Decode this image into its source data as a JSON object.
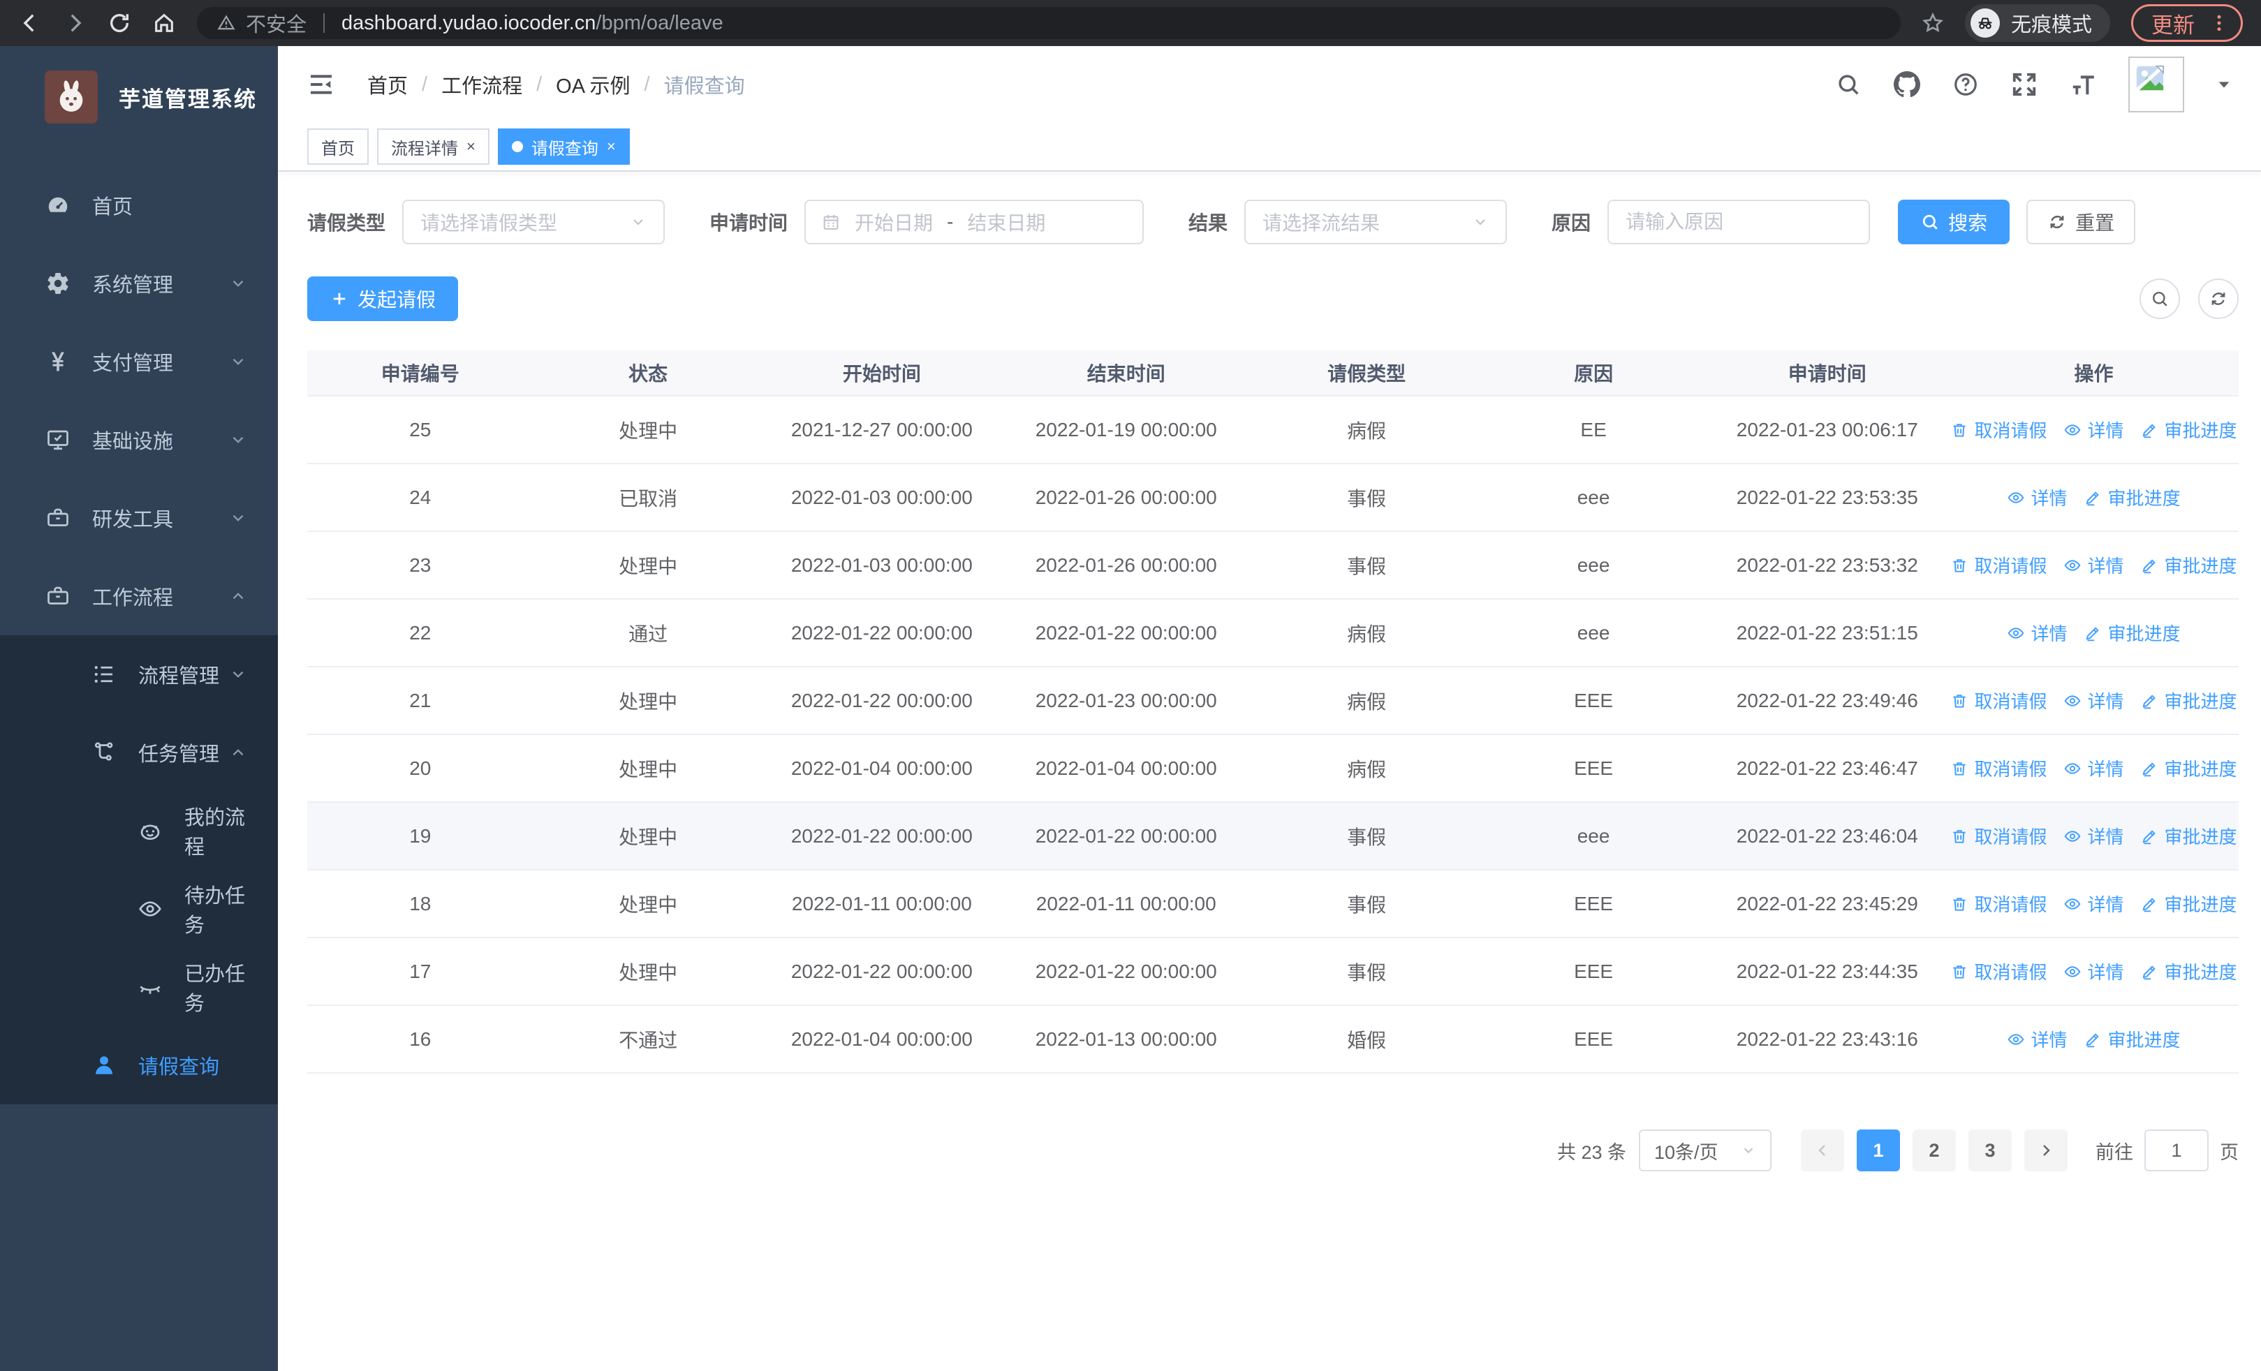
{
  "browser": {
    "security_warning": "不安全",
    "url_host": "dashboard.yudao.iocoder.cn",
    "url_path": "/bpm/oa/leave",
    "incognito_label": "无痕模式",
    "update_label": "更新"
  },
  "sidebar": {
    "logo_title": "芋道管理系统",
    "menu": [
      {
        "label": "首页",
        "icon": "dashboard-icon",
        "chevron": null
      },
      {
        "label": "系统管理",
        "icon": "gear-icon",
        "chevron": "down"
      },
      {
        "label": "支付管理",
        "icon": "yen-icon",
        "chevron": "down"
      },
      {
        "label": "基础设施",
        "icon": "monitor-icon",
        "chevron": "down"
      },
      {
        "label": "研发工具",
        "icon": "toolbox-icon",
        "chevron": "down"
      },
      {
        "label": "工作流程",
        "icon": "briefcase-icon",
        "chevron": "up"
      }
    ],
    "submenu": [
      {
        "label": "流程管理",
        "icon": "list-tree-icon",
        "chevron": "down",
        "level": 2,
        "active": false
      },
      {
        "label": "任务管理",
        "icon": "flow-icon",
        "chevron": "up",
        "level": 2,
        "active": false
      },
      {
        "label": "我的流程",
        "icon": "robot-face-icon",
        "chevron": null,
        "level": 3,
        "active": false
      },
      {
        "label": "待办任务",
        "icon": "eye-open-icon",
        "chevron": null,
        "level": 3,
        "active": false
      },
      {
        "label": "已办任务",
        "icon": "eye-closed-icon",
        "chevron": null,
        "level": 3,
        "active": false
      },
      {
        "label": "请假查询",
        "icon": "user-icon",
        "chevron": null,
        "level": 2,
        "active": true
      }
    ]
  },
  "header": {
    "breadcrumb": [
      "首页",
      "工作流程",
      "OA 示例",
      "请假查询"
    ]
  },
  "tabs": [
    {
      "label": "首页",
      "closable": false,
      "active": false
    },
    {
      "label": "流程详情",
      "closable": true,
      "active": false
    },
    {
      "label": "请假查询",
      "closable": true,
      "active": true
    }
  ],
  "filters": {
    "leave_type_label": "请假类型",
    "leave_type_placeholder": "请选择请假类型",
    "apply_time_label": "申请时间",
    "start_date_placeholder": "开始日期",
    "range_separator": "-",
    "end_date_placeholder": "结束日期",
    "result_label": "结果",
    "result_placeholder": "请选择流结果",
    "reason_label": "原因",
    "reason_placeholder": "请输入原因",
    "search_button": "搜索",
    "reset_button": "重置"
  },
  "toolbar": {
    "create_button": "发起请假"
  },
  "table": {
    "columns": [
      "申请编号",
      "状态",
      "开始时间",
      "结束时间",
      "请假类型",
      "原因",
      "申请时间",
      "操作"
    ],
    "action_labels": {
      "cancel": "取消请假",
      "detail": "详情",
      "progress": "审批进度"
    },
    "rows": [
      {
        "id": "25",
        "status": "处理中",
        "start": "2021-12-27 00:00:00",
        "end": "2022-01-19 00:00:00",
        "type": "病假",
        "reason": "EE",
        "applied": "2022-01-23 00:06:17",
        "cancellable": true,
        "highlighted": false
      },
      {
        "id": "24",
        "status": "已取消",
        "start": "2022-01-03 00:00:00",
        "end": "2022-01-26 00:00:00",
        "type": "事假",
        "reason": "eee",
        "applied": "2022-01-22 23:53:35",
        "cancellable": false,
        "highlighted": false
      },
      {
        "id": "23",
        "status": "处理中",
        "start": "2022-01-03 00:00:00",
        "end": "2022-01-26 00:00:00",
        "type": "事假",
        "reason": "eee",
        "applied": "2022-01-22 23:53:32",
        "cancellable": true,
        "highlighted": false
      },
      {
        "id": "22",
        "status": "通过",
        "start": "2022-01-22 00:00:00",
        "end": "2022-01-22 00:00:00",
        "type": "病假",
        "reason": "eee",
        "applied": "2022-01-22 23:51:15",
        "cancellable": false,
        "highlighted": false
      },
      {
        "id": "21",
        "status": "处理中",
        "start": "2022-01-22 00:00:00",
        "end": "2022-01-23 00:00:00",
        "type": "病假",
        "reason": "EEE",
        "applied": "2022-01-22 23:49:46",
        "cancellable": true,
        "highlighted": false
      },
      {
        "id": "20",
        "status": "处理中",
        "start": "2022-01-04 00:00:00",
        "end": "2022-01-04 00:00:00",
        "type": "病假",
        "reason": "EEE",
        "applied": "2022-01-22 23:46:47",
        "cancellable": true,
        "highlighted": false
      },
      {
        "id": "19",
        "status": "处理中",
        "start": "2022-01-22 00:00:00",
        "end": "2022-01-22 00:00:00",
        "type": "事假",
        "reason": "eee",
        "applied": "2022-01-22 23:46:04",
        "cancellable": true,
        "highlighted": true
      },
      {
        "id": "18",
        "status": "处理中",
        "start": "2022-01-11 00:00:00",
        "end": "2022-01-11 00:00:00",
        "type": "事假",
        "reason": "EEE",
        "applied": "2022-01-22 23:45:29",
        "cancellable": true,
        "highlighted": false
      },
      {
        "id": "17",
        "status": "处理中",
        "start": "2022-01-22 00:00:00",
        "end": "2022-01-22 00:00:00",
        "type": "事假",
        "reason": "EEE",
        "applied": "2022-01-22 23:44:35",
        "cancellable": true,
        "highlighted": false
      },
      {
        "id": "16",
        "status": "不通过",
        "start": "2022-01-04 00:00:00",
        "end": "2022-01-13 00:00:00",
        "type": "婚假",
        "reason": "EEE",
        "applied": "2022-01-22 23:43:16",
        "cancellable": false,
        "highlighted": false
      }
    ]
  },
  "pagination": {
    "total_text": "共 23 条",
    "page_size": "10条/页",
    "pages": [
      "1",
      "2",
      "3"
    ],
    "current_page": "1",
    "goto_label": "前往",
    "goto_value": "1",
    "goto_suffix": "页"
  },
  "colors": {
    "primary": "#409EFF",
    "sidebar_bg": "#304156",
    "submenu_bg": "#1f2d3d",
    "chrome_bg": "#2b2c2f",
    "update_accent": "#f28b82",
    "row_highlight": "#f5f7fa"
  }
}
